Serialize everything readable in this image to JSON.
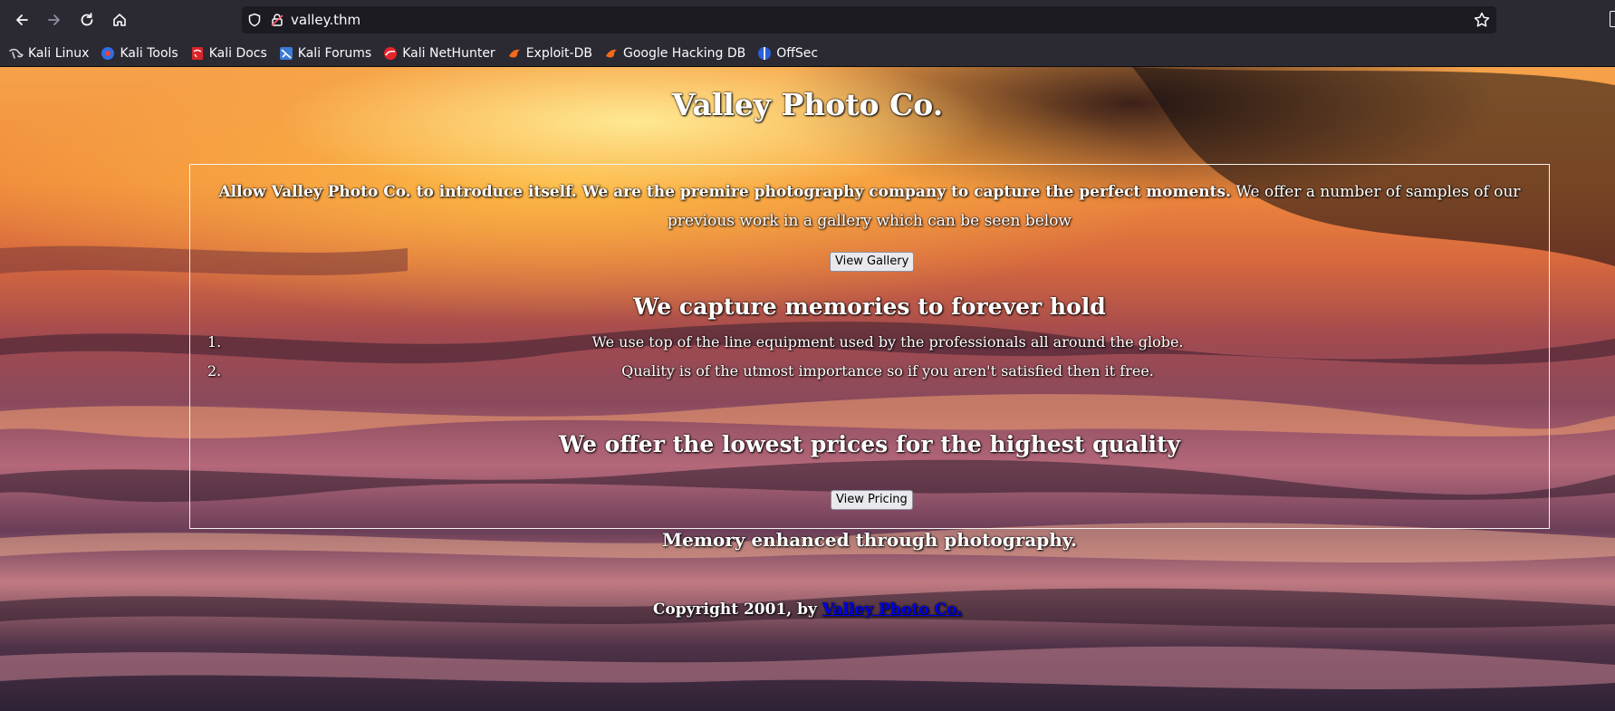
{
  "browser": {
    "url": "valley.thm",
    "bookmarks": [
      {
        "label": "Kali Linux",
        "icon": "kali-dragon-icon"
      },
      {
        "label": "Kali Tools",
        "icon": "kali-tools-icon"
      },
      {
        "label": "Kali Docs",
        "icon": "kali-docs-icon"
      },
      {
        "label": "Kali Forums",
        "icon": "kali-forums-icon"
      },
      {
        "label": "Kali NetHunter",
        "icon": "nethunter-icon"
      },
      {
        "label": "Exploit-DB",
        "icon": "exploit-db-icon"
      },
      {
        "label": "Google Hacking DB",
        "icon": "ghdb-icon"
      },
      {
        "label": "OffSec",
        "icon": "offsec-icon"
      }
    ]
  },
  "page": {
    "title": "Valley Photo Co.",
    "intro_bold": "Allow Valley Photo Co. to introduce itself. We are the premire photography company to capture the perfect moments.",
    "intro_rest": " We offer a number of samples of our previous work in a gallery which can be seen below",
    "gallery_button": "View Gallery",
    "heading_memories": "We capture memories to forever hold",
    "list": [
      {
        "num": "1.",
        "text": "We use top of the line equipment used by the professionals all around the globe."
      },
      {
        "num": "2.",
        "text": "Quality is of the utmost importance so if you aren't satisfied then it free."
      }
    ],
    "heading_prices": "We offer the lowest prices for the highest quality",
    "pricing_button": "View Pricing",
    "tagline": "Memory enhanced through photography.",
    "footer_prefix": "Copyright 2001, by ",
    "footer_link": "Valley Photo Co."
  }
}
